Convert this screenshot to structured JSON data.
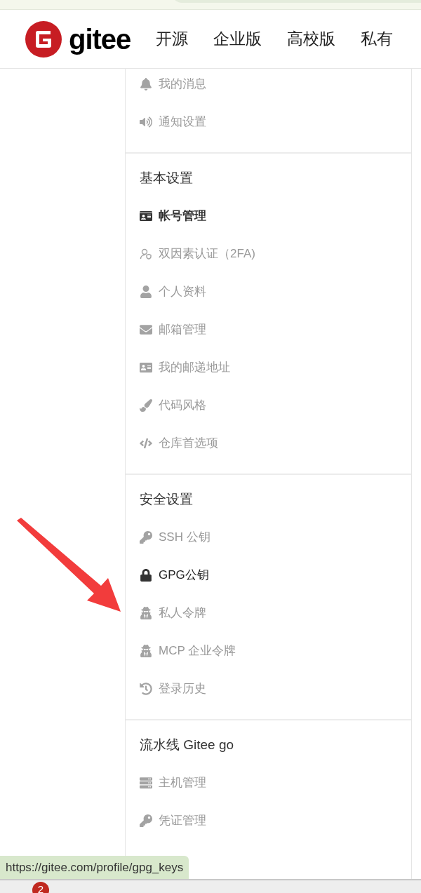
{
  "header": {
    "logo_text": "gitee",
    "nav": [
      "开源",
      "企业版",
      "高校版",
      "私有"
    ]
  },
  "sections": [
    {
      "items": [
        {
          "label": "我的消息",
          "selected": false,
          "hovered": false
        },
        {
          "label": "通知设置",
          "selected": false,
          "hovered": false
        }
      ]
    },
    {
      "title": "基本设置",
      "items": [
        {
          "label": "帐号管理",
          "selected": true,
          "hovered": false
        },
        {
          "label": "双因素认证（2FA)",
          "selected": false,
          "hovered": false
        },
        {
          "label": "个人资料",
          "selected": false,
          "hovered": false
        },
        {
          "label": "邮箱管理",
          "selected": false,
          "hovered": false
        },
        {
          "label": "我的邮递地址",
          "selected": false,
          "hovered": false
        },
        {
          "label": "代码风格",
          "selected": false,
          "hovered": false
        },
        {
          "label": "仓库首选项",
          "selected": false,
          "hovered": false
        }
      ]
    },
    {
      "title": "安全设置",
      "items": [
        {
          "label": "SSH 公钥",
          "selected": false,
          "hovered": false
        },
        {
          "label": "GPG公钥",
          "selected": false,
          "hovered": true
        },
        {
          "label": "私人令牌",
          "selected": false,
          "hovered": false
        },
        {
          "label": "MCP 企业令牌",
          "selected": false,
          "hovered": false
        },
        {
          "label": "登录历史",
          "selected": false,
          "hovered": false
        }
      ]
    },
    {
      "title": "流水线 Gitee go",
      "items": [
        {
          "label": "主机管理",
          "selected": false,
          "hovered": false
        },
        {
          "label": "凭证管理",
          "selected": false,
          "hovered": false
        }
      ]
    }
  ],
  "status_url": "https://gitee.com/profile/gpg_keys",
  "taskbar": {
    "badge": "2"
  }
}
